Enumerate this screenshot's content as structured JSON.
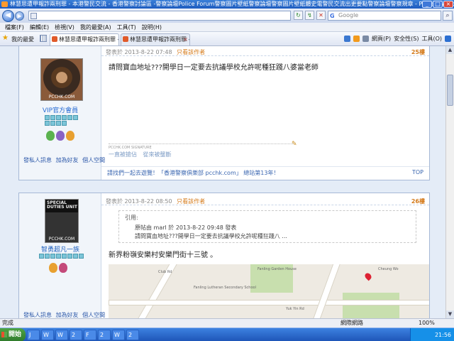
{
  "window": {
    "title": "林慧思遭甲報詐兩刑罪 - 本港警民交流 - 香港警察討論區 -警察論壇Police Forum警察圖片壁紙警察論壇警察圖片壁紙體史電警民交流出更要點警察論壇警察規章 - Power - Windows Intern"
  },
  "address": {
    "search_placeholder": "Google",
    "search_brand": "G"
  },
  "menu": [
    "檔案(F)",
    "編輯(E)",
    "檢視(V)",
    "我的最愛(A)",
    "工具(T)",
    "說明(H)"
  ],
  "favbar": {
    "label": "我的最愛",
    "tab1": "林慧思遭甲報詐兩刑罪 - 本港警...",
    "tab2": "林慧思遭甲報詐兩刑罪 - 香港警察...",
    "commands": [
      "網頁(P)",
      "安全性(S)",
      "工具(O)"
    ]
  },
  "post1": {
    "meta": "發表於 2013-8-22 07:48",
    "author_only": "只看該作者",
    "floor": "25樓",
    "avatar_caption": "PCCHK.COM",
    "username": "VIP官方會員",
    "body": "請問寶血地址???開學日一定要去抗議學校允許呢種狂踐八婆當老師",
    "signature": "PCCHK.COM  SIGNATURE",
    "sig_links": [
      "一直被搶佔",
      "從來被壟斷"
    ],
    "actions": [
      "發私人訊息",
      "加為好友",
      "個人空間"
    ],
    "footnote": "請找們一起去遊覽！「香港警察俱樂部 pcchk.com」 總站第13年！",
    "top": "TOP"
  },
  "post2": {
    "meta": "發表於 2013-8-22 08:50",
    "author_only": "只看該作者",
    "floor": "26樓",
    "avatar_text": "SPECIAL\nDUTIES\nUNIT",
    "avatar_caption": "PCCHK.COM",
    "username": "智勇超凡一族",
    "quote_label": "引用:",
    "quote_meta": "原帖由 marl 於 2013-8-22 09:48 發表",
    "quote_body": "請問寶血地址???開學日一定要去抗議學校允許呢種狂踐八 ...",
    "body": "新界粉嶺安樂村安樂門街十三號 。",
    "map_labels": [
      "Fanling Garden House",
      "Fanling Lutheran Secondary School",
      "Club Rd",
      "Yuk Yin Rd",
      "Cheung Wo"
    ],
    "actions": [
      "發私人訊息",
      "加為好友",
      "個人空間"
    ]
  },
  "status": {
    "left": "完成",
    "zone": "網際網路",
    "zoom": "100%"
  },
  "taskbar": {
    "start": "開始",
    "items": [
      "J",
      "W",
      "W",
      "2",
      "F",
      "2",
      "W",
      "2"
    ],
    "clock": "21:56"
  }
}
